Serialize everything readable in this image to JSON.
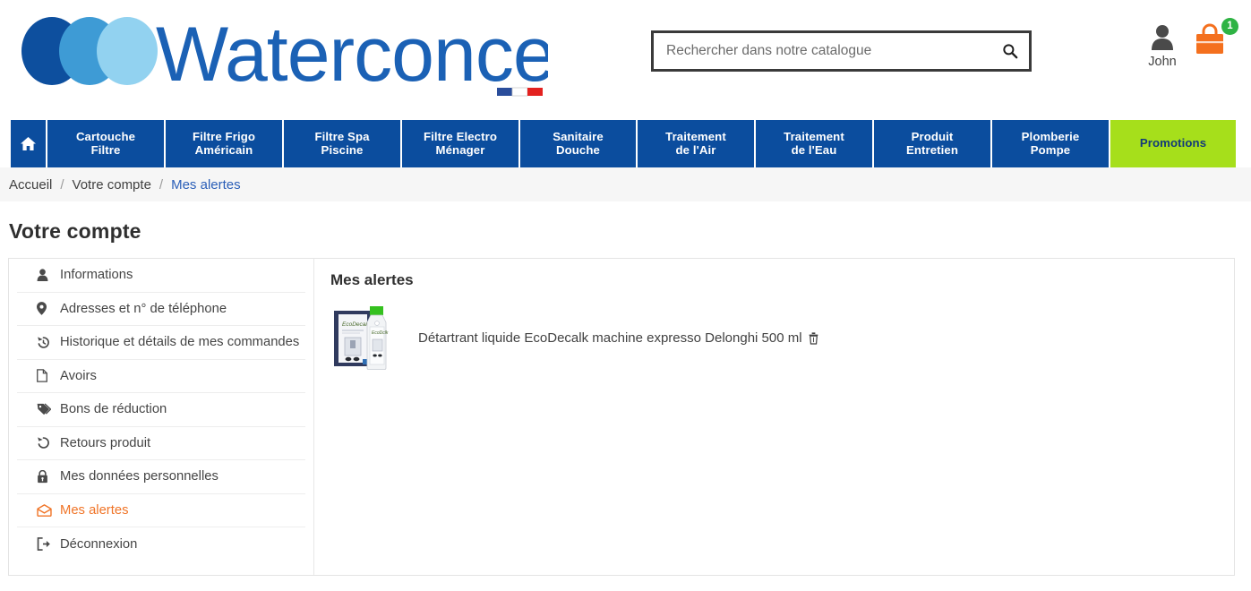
{
  "brand": {
    "name": "Waterconcept",
    "logo_colors": [
      "#0d4f9e",
      "#3e9bd5",
      "#92d2f0"
    ],
    "flag_colors": [
      "#2a4d9b",
      "#ffffff",
      "#e3211f"
    ]
  },
  "search": {
    "placeholder": "Rechercher dans notre catalogue",
    "value": "",
    "icon": "search-icon"
  },
  "account": {
    "user_icon": "user-icon",
    "user_name": "John",
    "cart_icon": "shopping-bag-icon",
    "cart_count": "1",
    "cart_badge_color": "#2fb344"
  },
  "nav": {
    "home_icon": "home-icon",
    "bg_color": "#0b4d9e",
    "promo_color": "#a6df1b",
    "items": [
      {
        "label": "Cartouche\nFiltre",
        "promo": false
      },
      {
        "label": "Filtre Frigo\nAméricain",
        "promo": false
      },
      {
        "label": "Filtre Spa\nPiscine",
        "promo": false
      },
      {
        "label": "Filtre Electro\nMénager",
        "promo": false
      },
      {
        "label": "Sanitaire\nDouche",
        "promo": false
      },
      {
        "label": "Traitement\nde l'Air",
        "promo": false
      },
      {
        "label": "Traitement\nde l'Eau",
        "promo": false
      },
      {
        "label": "Produit\nEntretien",
        "promo": false
      },
      {
        "label": "Plomberie\nPompe",
        "promo": false
      },
      {
        "label": "Promotions",
        "promo": true
      }
    ]
  },
  "breadcrumb": {
    "items": [
      "Accueil",
      "Votre compte",
      "Mes alertes"
    ],
    "separator": "/"
  },
  "page": {
    "title": "Votre compte"
  },
  "sidebar": {
    "items": [
      {
        "label": "Informations",
        "icon": "user-icon",
        "active": false
      },
      {
        "label": "Adresses et n° de téléphone",
        "icon": "map-pin-icon",
        "active": false
      },
      {
        "label": "Historique et détails de mes commandes",
        "icon": "history-icon",
        "active": false
      },
      {
        "label": "Avoirs",
        "icon": "file-icon",
        "active": false
      },
      {
        "label": "Bons de réduction",
        "icon": "tag-icon",
        "active": false
      },
      {
        "label": "Retours produit",
        "icon": "history-icon",
        "active": false
      },
      {
        "label": "Mes données personnelles",
        "icon": "lock-icon",
        "active": false
      },
      {
        "label": "Mes alertes",
        "icon": "envelope-icon",
        "active": true
      },
      {
        "label": "Déconnexion",
        "icon": "sign-out-icon",
        "active": false
      }
    ],
    "active_color": "#f07427"
  },
  "alerts": {
    "title": "Mes alertes",
    "items": [
      {
        "name": "Détartrant liquide EcoDecalk machine expresso Delonghi 500 ml",
        "thumb_alt": "product-thumbnail",
        "delete_icon": "trash-icon"
      }
    ]
  }
}
